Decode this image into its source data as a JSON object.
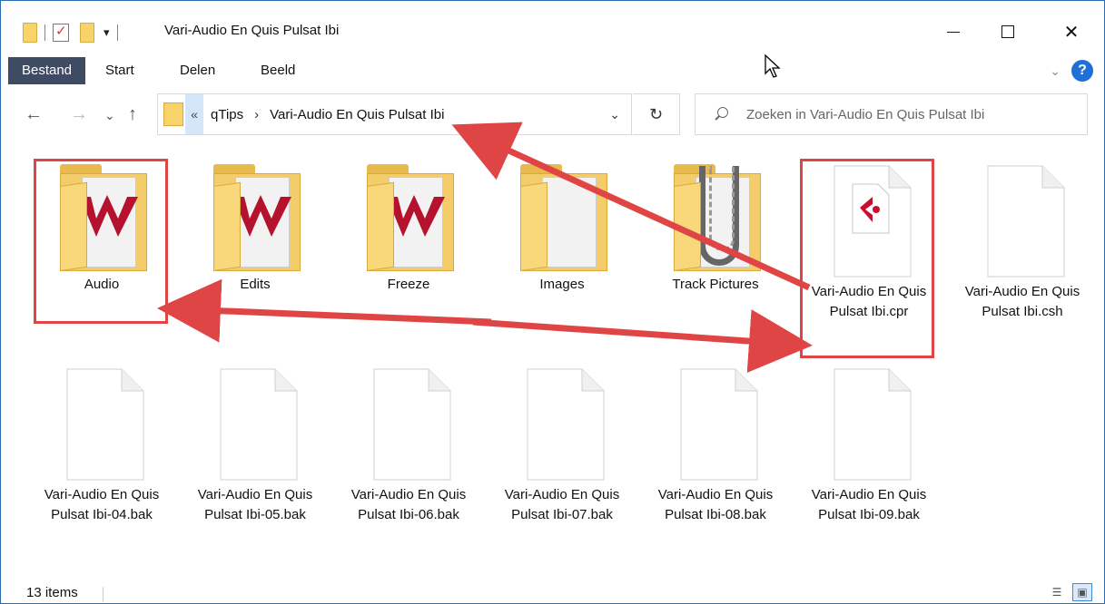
{
  "window": {
    "title": "Vari-Audio En Quis Pulsat Ibi",
    "minimize_glyph": "—",
    "maximize_glyph": "☐",
    "close_glyph": "✕"
  },
  "quick_access": {
    "dropdown_glyph": "▾"
  },
  "ribbon": {
    "tabs": [
      "Bestand",
      "Start",
      "Delen",
      "Beeld"
    ],
    "expand_glyph": "⌄",
    "help_glyph": "?"
  },
  "nav": {
    "back_glyph": "←",
    "forward_glyph": "→",
    "recent_glyph": "⌄",
    "up_glyph": "↑"
  },
  "address": {
    "overflow_glyph": "«",
    "crumbs": [
      "qTips",
      "Vari-Audio En Quis Pulsat Ibi"
    ],
    "separator": "›",
    "dropdown_glyph": "⌄",
    "refresh_glyph": "↻"
  },
  "search": {
    "placeholder": "Zoeken in Vari-Audio En Quis Pulsat Ibi"
  },
  "items": [
    {
      "label": "Audio",
      "kind": "folder",
      "icon": "wavelab-folder-icon"
    },
    {
      "label": "Edits",
      "kind": "folder",
      "icon": "wavelab-folder-icon"
    },
    {
      "label": "Freeze",
      "kind": "folder",
      "icon": "wavelab-folder-icon"
    },
    {
      "label": "Images",
      "kind": "folder",
      "icon": "folder-icon"
    },
    {
      "label": "Track Pictures",
      "kind": "folder",
      "icon": "horseshoe-folder-icon"
    },
    {
      "label": "Vari-Audio En Quis Pulsat Ibi.cpr",
      "kind": "file",
      "icon": "cubase-project-icon"
    },
    {
      "label": "Vari-Audio En Quis Pulsat Ibi.csh",
      "kind": "file",
      "icon": "blank-file-icon"
    },
    {
      "label": "Vari-Audio En Quis Pulsat Ibi-04.bak",
      "kind": "file",
      "icon": "blank-file-icon"
    },
    {
      "label": "Vari-Audio En Quis Pulsat Ibi-05.bak",
      "kind": "file",
      "icon": "blank-file-icon"
    },
    {
      "label": "Vari-Audio En Quis Pulsat Ibi-06.bak",
      "kind": "file",
      "icon": "blank-file-icon"
    },
    {
      "label": "Vari-Audio En Quis Pulsat Ibi-07.bak",
      "kind": "file",
      "icon": "blank-file-icon"
    },
    {
      "label": "Vari-Audio En Quis Pulsat Ibi-08.bak",
      "kind": "file",
      "icon": "blank-file-icon"
    },
    {
      "label": "Vari-Audio En Quis Pulsat Ibi-09.bak",
      "kind": "file",
      "icon": "blank-file-icon"
    }
  ],
  "status": {
    "count": "13 items"
  },
  "colors": {
    "annotation_red": "#e04545",
    "wavelab_red": "#b5122e",
    "cubase_red": "#c8102e",
    "ribbon_active": "#3f4a63",
    "help_blue": "#1e6fd6"
  }
}
